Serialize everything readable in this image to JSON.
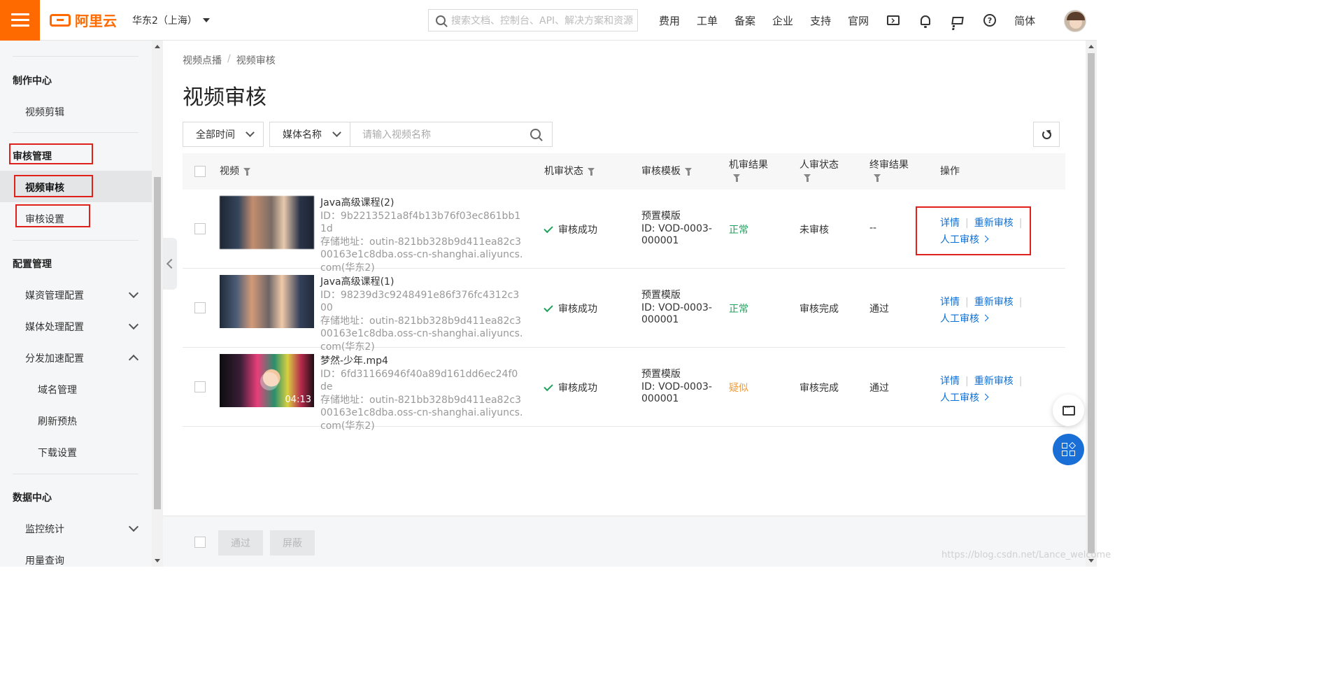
{
  "header": {
    "brand": "阿里云",
    "region": "华东2（上海）",
    "search_placeholder": "搜索文档、控制台、API、解决方案和资源",
    "nav": [
      "费用",
      "工单",
      "备案",
      "企业",
      "支持",
      "官网"
    ],
    "lang": "简体",
    "icons": [
      "terminal-icon",
      "bell-icon",
      "cart-icon",
      "help-icon"
    ]
  },
  "sidebar": {
    "production_center": "制作中心",
    "video_edit": "视频剪辑",
    "review_manage": "审核管理",
    "video_review": "视频审核",
    "review_settings": "审核设置",
    "config_manage": "配置管理",
    "media_asset_config": "媒资管理配置",
    "media_process_config": "媒体处理配置",
    "dist_accel_config": "分发加速配置",
    "domain_manage": "域名管理",
    "refresh_prefetch": "刷新预热",
    "download_settings": "下载设置",
    "data_center": "数据中心",
    "monitor_stats": "监控统计",
    "usage_query": "用量查询"
  },
  "breadcrumb": {
    "root": "视频点播",
    "sep": "/",
    "current": "视频审核"
  },
  "page_title": "视频审核",
  "filters": {
    "time": "全部时间",
    "field": "媒体名称",
    "input_placeholder": "请输入视频名称"
  },
  "table": {
    "headers": {
      "video": "视频",
      "machine_status": "机审状态",
      "template": "审核模板",
      "machine_result": "机审结果",
      "human_status": "人审状态",
      "final_result": "终审结果",
      "ops": "操作"
    },
    "rows": [
      {
        "title": "Java高级课程(2)",
        "id": "ID：9b2213521a8f4b13b76f03ec861bb11d",
        "storage": "存储地址：outin-821bb328b9d411ea82c300163e1c8dba.oss-cn-shanghai.aliyuncs.com(华东2)",
        "duration": "",
        "machine_status": "审核成功",
        "template_name": "预置模版",
        "template_id": "ID: VOD-0003-000001",
        "machine_result": "正常",
        "human_status": "未审核",
        "final_result": "--"
      },
      {
        "title": "Java高级课程(1)",
        "id": "ID：98239d3c9248491e86f376fc4312c300",
        "storage": "存储地址：outin-821bb328b9d411ea82c300163e1c8dba.oss-cn-shanghai.aliyuncs.com(华东2)",
        "duration": "",
        "machine_status": "审核成功",
        "template_name": "预置模版",
        "template_id": "ID: VOD-0003-000001",
        "machine_result": "正常",
        "human_status": "审核完成",
        "final_result": "通过"
      },
      {
        "title": "梦然-少年.mp4",
        "id": "ID：6fd31166946f40a89d161dd6ec24f0de",
        "storage": "存储地址：outin-821bb328b9d411ea82c300163e1c8dba.oss-cn-shanghai.aliyuncs.com(华东2)",
        "duration": "04:13",
        "machine_status": "审核成功",
        "template_name": "预置模版",
        "template_id": "ID: VOD-0003-000001",
        "machine_result": "疑似",
        "human_status": "审核完成",
        "final_result": "通过"
      }
    ],
    "op_labels": {
      "detail": "详情",
      "re_review": "重新审核",
      "manual_review": "人工审核"
    }
  },
  "bottom": {
    "pass": "通过",
    "block": "屏蔽"
  },
  "watermark": "https://blog.csdn.net/Lance_welcome",
  "colors": {
    "accent": "#ff6a00",
    "link": "#0a6fd6",
    "ok": "#1fa35c",
    "warn": "#f29b38",
    "highlight_box": "#e0201b"
  }
}
